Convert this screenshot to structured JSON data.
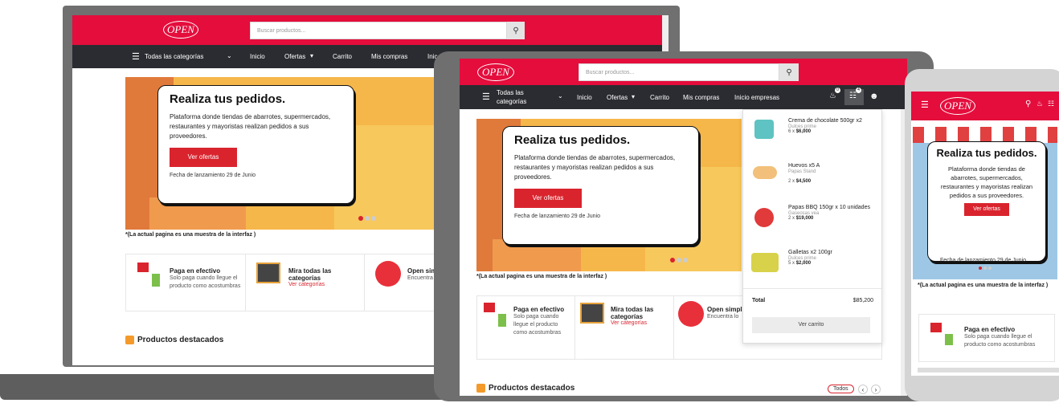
{
  "brand": {
    "logo_text": "OPEN",
    "accent": "#e40d3c",
    "nav_bg": "#2b2c31",
    "button": "#d9242e"
  },
  "search": {
    "placeholder": "Buscar productos..."
  },
  "nav": {
    "categories": "Todas las categorías",
    "categories_split": [
      "Todas las",
      "categorías"
    ],
    "items": [
      "Inicio",
      "Ofertas",
      "Carrito",
      "Mis compras",
      "Inicio empresas"
    ],
    "items_desktop_visible_last": "Inic",
    "bell_count": "0",
    "cart_count": "4"
  },
  "hero": {
    "title": "Realiza tus pedidos.",
    "text": "Plataforma donde tiendas de abarrotes, supermercados, restaurantes y mayoristas realizan pedidos a sus proveedores.",
    "button": "Ver ofertas",
    "date": "Fecha de lanzamiento 29 de Junio",
    "note": "*(La actual pagina es una muestra de la interfaz )"
  },
  "features": [
    {
      "title": "Paga en efectivo",
      "text": "Solo paga cuando llegue el producto como acostumbras",
      "icon": "cash-icon"
    },
    {
      "title": "Mira todas las categorías",
      "link": "Ver categorías",
      "icon": "shelf-icon"
    },
    {
      "title": "Open simple",
      "text": "Encuentra lo",
      "icon": "store-icon"
    }
  ],
  "featured": {
    "title": "Productos destacados",
    "filter": "Todos"
  },
  "cart": {
    "items": [
      {
        "name": "Crema de chocolate 500gr x2",
        "brand": "Dulces prime",
        "qty": "6 x",
        "price": "$6,000"
      },
      {
        "name": "Huevos x5 A",
        "brand": "Papas Stand",
        "qty": "2 x",
        "price": "$4,500"
      },
      {
        "name": "Papas BBQ 150gr x 10 unidades",
        "brand": "Gaseosas vea",
        "qty": "2 x",
        "price": "$19,000"
      },
      {
        "name": "Galletas x2 100gr",
        "brand": "Dulces prime",
        "qty": "5 x",
        "price": "$2,000"
      }
    ],
    "total_label": "Total",
    "total_value": "$85,200",
    "view_button": "Ver carrito"
  },
  "mobile": {
    "hero_title": "Realiza tus pedidos.",
    "hero_text": "Plataforma donde tiendas de abarrotes, supermercados, restaurantes y mayoristas realizan pedidos a sus proveedores.",
    "hero_date": "Fecha de lanzamiento 29 de Junio"
  }
}
